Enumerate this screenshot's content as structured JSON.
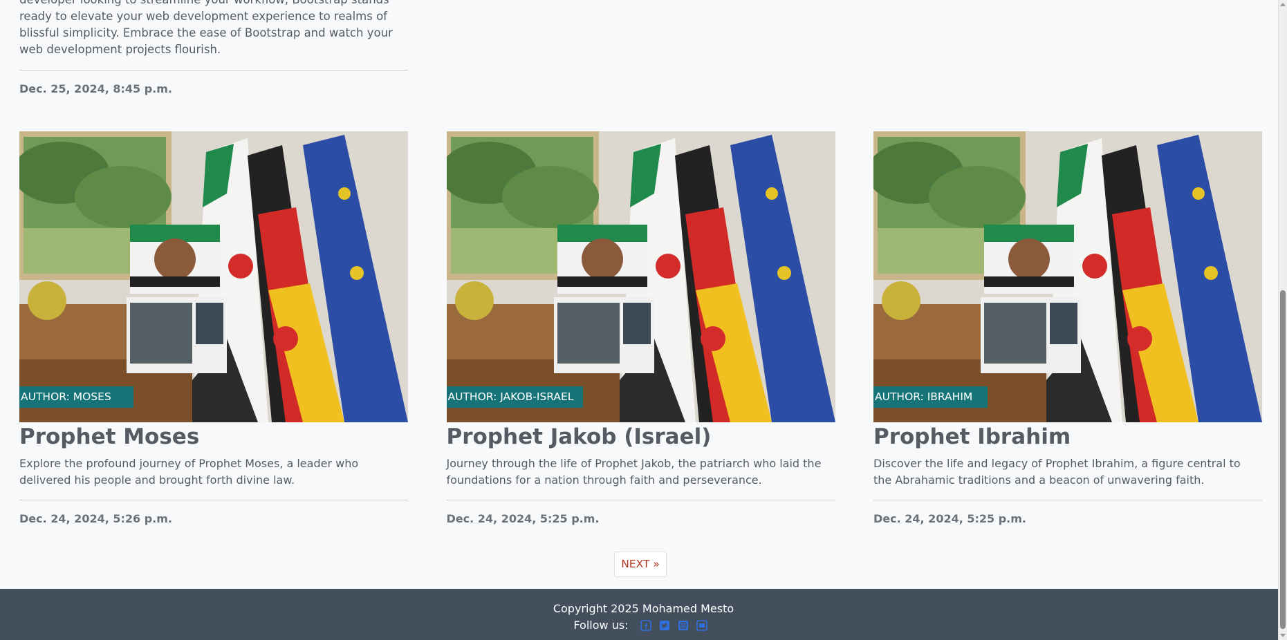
{
  "top_card": {
    "description": "developer looking to streamline your workflow, Bootstrap stands ready to elevate your web development experience to realms of blissful simplicity. Embrace the ease of Bootstrap and watch your web development projects flourish.",
    "date": "Dec. 25, 2024, 8:45 p.m."
  },
  "posts": [
    {
      "author_badge": "AUTHOR: MOSES",
      "title": "Prophet Moses",
      "description": "Explore the profound journey of Prophet Moses, a leader who delivered his people and brought forth divine law.",
      "date": "Dec. 24, 2024, 5:26 p.m."
    },
    {
      "author_badge": "AUTHOR: JAKOB-ISRAEL",
      "title": "Prophet Jakob (Israel)",
      "description": "Journey through the life of Prophet Jakob, the patriarch who laid the foundations for a nation through faith and perseverance.",
      "date": "Dec. 24, 2024, 5:25 p.m."
    },
    {
      "author_badge": "AUTHOR: IBRAHIM",
      "title": "Prophet Ibrahim",
      "description": "Discover the life and legacy of Prophet Ibrahim, a figure central to the Abrahamic traditions and a beacon of unwavering faith.",
      "date": "Dec. 24, 2024, 5:25 p.m."
    }
  ],
  "pagination": {
    "next_label": "NEXT »"
  },
  "footer": {
    "copyright": "Copyright 2025 Mohamed Mesto",
    "follow_label": "Follow us:",
    "social_icons": [
      "facebook-icon",
      "twitter-icon",
      "linkedin-icon",
      "youtube-icon"
    ]
  },
  "colors": {
    "badge": "#167478",
    "footer_bg": "#444f5e",
    "next_text": "#b0361f",
    "social_icon": "#2f6fe0",
    "page_bg": "#f8f9fa"
  }
}
